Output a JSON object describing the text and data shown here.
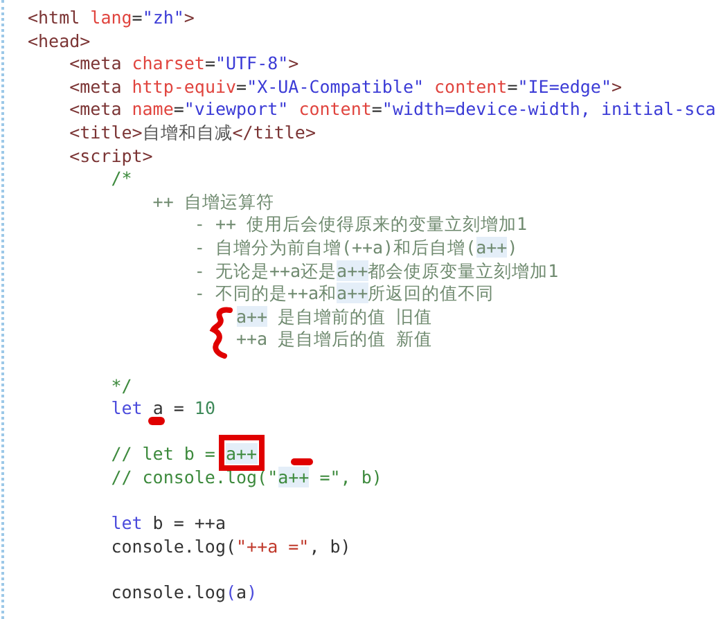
{
  "lines": [
    {
      "kind": "top",
      "tokens": [
        {
          "text": "<html",
          "kind": "tag"
        },
        {
          "text": " lang",
          "kind": "attr"
        },
        {
          "text": "=",
          "kind": "plain"
        },
        {
          "text": "\"zh\"",
          "kind": "string"
        },
        {
          "text": ">",
          "kind": "tag"
        }
      ]
    },
    {
      "kind": "top",
      "tokens": [
        {
          "text": "<head>",
          "kind": "tag"
        }
      ]
    },
    {
      "kind": "head",
      "tokens": [
        {
          "text": "<meta",
          "kind": "tag"
        },
        {
          "text": " charset",
          "kind": "attr"
        },
        {
          "text": "=",
          "kind": "plain"
        },
        {
          "text": "\"UTF-8\"",
          "kind": "string"
        },
        {
          "text": ">",
          "kind": "tag"
        }
      ]
    },
    {
      "kind": "head",
      "tokens": [
        {
          "text": "<meta",
          "kind": "tag"
        },
        {
          "text": " http-equiv",
          "kind": "attr"
        },
        {
          "text": "=",
          "kind": "plain"
        },
        {
          "text": "\"X-UA-Compatible\"",
          "kind": "string"
        },
        {
          "text": " content",
          "kind": "attr"
        },
        {
          "text": "=",
          "kind": "plain"
        },
        {
          "text": "\"IE=edge\"",
          "kind": "string"
        },
        {
          "text": ">",
          "kind": "tag"
        }
      ]
    },
    {
      "kind": "head",
      "tokens": [
        {
          "text": "<meta",
          "kind": "tag"
        },
        {
          "text": " name",
          "kind": "attr"
        },
        {
          "text": "=",
          "kind": "plain"
        },
        {
          "text": "\"viewport\"",
          "kind": "string"
        },
        {
          "text": " content",
          "kind": "attr"
        },
        {
          "text": "=",
          "kind": "plain"
        },
        {
          "text": "\"width=device-width, initial-sca",
          "kind": "string"
        }
      ]
    },
    {
      "kind": "head",
      "tokens": [
        {
          "text": "<title>",
          "kind": "tag"
        },
        {
          "text": "自增和自减",
          "kind": "text"
        },
        {
          "text": "</title>",
          "kind": "tag"
        }
      ]
    },
    {
      "kind": "head",
      "tokens": [
        {
          "text": "<script>",
          "kind": "tag"
        }
      ]
    },
    {
      "kind": "script",
      "tokens": [
        {
          "text": "/*",
          "kind": "comment"
        }
      ]
    },
    {
      "kind": "doc-title",
      "tokens": [
        {
          "text": "++ 自增运算符",
          "kind": "doc"
        }
      ]
    },
    {
      "kind": "doc-item",
      "tokens": [
        {
          "text": "- ++ 使用后会使得原来的变量立刻增加1",
          "kind": "doc"
        }
      ]
    },
    {
      "kind": "doc-item",
      "tokens": [
        {
          "text": "- 自增分为前自增(++a)和后自增(",
          "kind": "doc"
        },
        {
          "text": "a++",
          "kind": "doc",
          "highlighted": true
        },
        {
          "text": ")",
          "kind": "doc"
        }
      ]
    },
    {
      "kind": "doc-item",
      "tokens": [
        {
          "text": "- 无论是++a还是",
          "kind": "doc"
        },
        {
          "text": "a++",
          "kind": "doc",
          "highlighted": true
        },
        {
          "text": "都会使原变量立刻增加1",
          "kind": "doc"
        }
      ]
    },
    {
      "kind": "doc-item",
      "tokens": [
        {
          "text": "- 不同的是++a和",
          "kind": "doc"
        },
        {
          "text": "a++",
          "kind": "doc",
          "highlighted": true
        },
        {
          "text": "所返回的值不同",
          "kind": "doc"
        }
      ]
    },
    {
      "kind": "doc-sub",
      "tokens": [
        {
          "text": "a++",
          "kind": "doc",
          "highlighted": true,
          "braced": true
        },
        {
          "text": " 是自增前的值 旧值",
          "kind": "doc"
        }
      ]
    },
    {
      "kind": "doc-sub",
      "tokens": [
        {
          "text": "++a 是自增后的值 新值",
          "kind": "doc"
        }
      ]
    },
    {
      "kind": "blank"
    },
    {
      "kind": "script",
      "tokens": [
        {
          "text": "*/",
          "kind": "comment"
        }
      ]
    },
    {
      "kind": "script",
      "tokens": [
        {
          "text": "let ",
          "kind": "keyword"
        },
        {
          "text": "a",
          "kind": "plain",
          "underlined": true
        },
        {
          "text": " = ",
          "kind": "plain"
        },
        {
          "text": "10",
          "kind": "number"
        }
      ]
    },
    {
      "kind": "blank"
    },
    {
      "kind": "script",
      "tokens": [
        {
          "text": "// let b = ",
          "kind": "comment"
        },
        {
          "text": "a++",
          "kind": "comment",
          "highlighted": true,
          "boxed": true,
          "dashed": true
        }
      ]
    },
    {
      "kind": "script",
      "tokens": [
        {
          "text": "// console.log(\"",
          "kind": "comment"
        },
        {
          "text": "a++",
          "kind": "comment",
          "highlighted": true
        },
        {
          "text": " =\", b)",
          "kind": "comment"
        }
      ]
    },
    {
      "kind": "blank"
    },
    {
      "kind": "script",
      "tokens": [
        {
          "text": "let",
          "kind": "keyword"
        },
        {
          "text": " b = ++a",
          "kind": "plain"
        }
      ]
    },
    {
      "kind": "script",
      "tokens": [
        {
          "text": "console.log(",
          "kind": "plain"
        },
        {
          "text": "\"++a =\"",
          "kind": "logstring"
        },
        {
          "text": ", b)",
          "kind": "plain"
        }
      ]
    },
    {
      "kind": "blank"
    },
    {
      "kind": "script",
      "tokens": [
        {
          "text": "console.log",
          "kind": "plain"
        },
        {
          "text": "(",
          "kind": "punct"
        },
        {
          "text": "a",
          "kind": "plain"
        },
        {
          "text": ")",
          "kind": "punct"
        }
      ]
    }
  ]
}
